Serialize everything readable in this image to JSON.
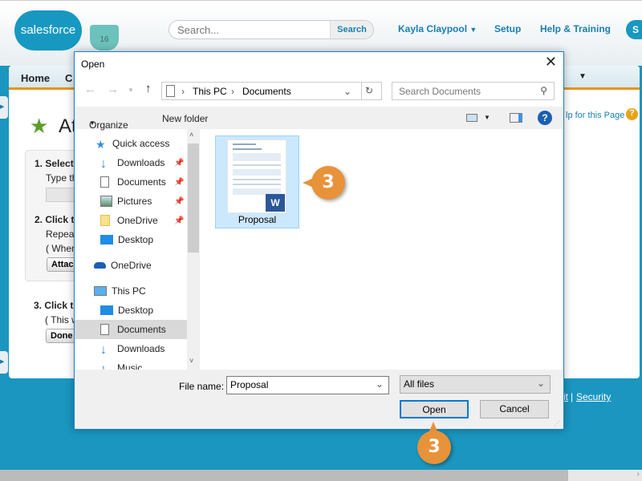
{
  "header": {
    "logo": "salesforce",
    "mug_badge": "16",
    "search_placeholder": "Search...",
    "search_button": "Search",
    "user": "Kayla Claypool",
    "setup": "Setup",
    "help": "Help & Training",
    "extra_button": "S"
  },
  "nav": {
    "tabs": [
      "Home",
      "C"
    ]
  },
  "page": {
    "title": "At",
    "help_link": "lp for this Page",
    "step1": "1. Select",
    "step1_text": "Type th",
    "step2": "2. Click t",
    "step2_text": "Repea",
    "step2_note": "( When",
    "attach_btn": "Attach",
    "step3": "3. Click t",
    "step3_note": "( This w",
    "done_btn": "Done",
    "footer_links": [
      "it",
      "Security"
    ]
  },
  "dialog": {
    "title": "Open",
    "breadcrumb": [
      "This PC",
      "Documents"
    ],
    "search_placeholder": "Search Documents",
    "toolbar": {
      "organize": "Organize",
      "new_folder": "New folder"
    },
    "tree": [
      {
        "label": "Quick access",
        "icon": "star-icon"
      },
      {
        "label": "Downloads",
        "icon": "download-icon",
        "pinned": true
      },
      {
        "label": "Documents",
        "icon": "document-icon",
        "pinned": true
      },
      {
        "label": "Pictures",
        "icon": "picture-icon",
        "pinned": true
      },
      {
        "label": "OneDrive",
        "icon": "folder-icon",
        "pinned": true
      },
      {
        "label": "Desktop",
        "icon": "desktop-icon"
      },
      {
        "label": "OneDrive",
        "icon": "cloud-icon"
      },
      {
        "label": "This PC",
        "icon": "computer-icon"
      },
      {
        "label": "Desktop",
        "icon": "desktop-icon"
      },
      {
        "label": "Documents",
        "icon": "document-icon",
        "selected": true
      },
      {
        "label": "Downloads",
        "icon": "download-icon"
      },
      {
        "label": "Music",
        "icon": "music-icon"
      }
    ],
    "files": [
      {
        "name": "Proposal",
        "type": "word",
        "selected": true
      }
    ],
    "file_name_label": "File name:",
    "file_name_value": "Proposal",
    "file_type": "All files",
    "open_button": "Open",
    "cancel_button": "Cancel"
  },
  "callouts": [
    "3",
    "3"
  ],
  "colors": {
    "accent": "#1798c1",
    "callout": "#e8923a",
    "nav_underline": "#e8931c",
    "selection": "#cce8ff"
  }
}
